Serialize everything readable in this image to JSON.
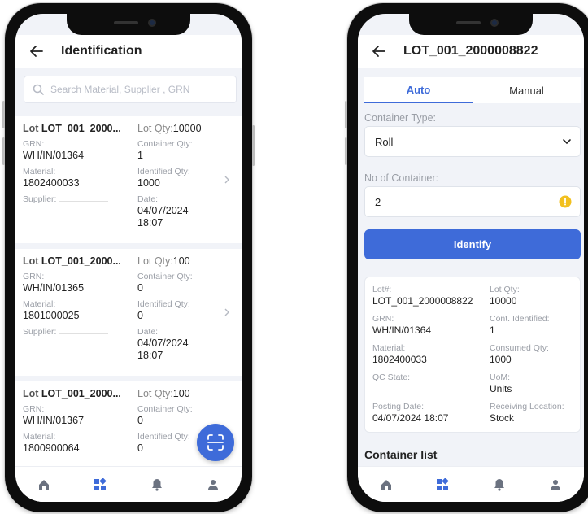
{
  "left_screen": {
    "title": "Identification",
    "search_placeholder": "Search Material, Supplier , GRN",
    "labels": {
      "lot": "Lot",
      "lot_qty": "Lot Qty:",
      "grn": "GRN:",
      "container_qty": "Container Qty:",
      "material": "Material:",
      "identified_qty": "Identified Qty:",
      "supplier": "Supplier:",
      "date": "Date:"
    },
    "cards": [
      {
        "lot": "LOT_001_2000...",
        "lot_qty": "10000",
        "grn": "WH/IN/01364",
        "container_qty": "1",
        "material": "1802400033",
        "identified_qty": "1000",
        "date": "04/07/2024",
        "time": "18:07"
      },
      {
        "lot": "LOT_001_2000...",
        "lot_qty": "100",
        "grn": "WH/IN/01365",
        "container_qty": "0",
        "material": "1801000025",
        "identified_qty": "0",
        "date": "04/07/2024",
        "time": "18:07"
      },
      {
        "lot": "LOT_001_2000...",
        "lot_qty": "100",
        "grn": "WH/IN/01367",
        "container_qty": "0",
        "material": "1800900064",
        "identified_qty": "0"
      }
    ]
  },
  "right_screen": {
    "title": "LOT_001_2000008822",
    "tabs": {
      "auto": "Auto",
      "manual": "Manual"
    },
    "container_type_label": "Container Type:",
    "container_type_value": "Roll",
    "no_of_container_label": "No of Container:",
    "no_of_container_value": "2",
    "identify_button": "Identify",
    "details": {
      "lot_label": "Lot#:",
      "lot_value": "LOT_001_2000008822",
      "lot_qty_label": "Lot Qty:",
      "lot_qty_value": "10000",
      "grn_label": "GRN:",
      "grn_value": "WH/IN/01364",
      "cont_identified_label": "Cont. Identified:",
      "cont_identified_value": "1",
      "material_label": "Material:",
      "material_value": "1802400033",
      "consumed_qty_label": "Consumed Qty:",
      "consumed_qty_value": "1000",
      "qc_state_label": "QC State:",
      "uom_label": "UoM:",
      "uom_value": "Units",
      "posting_date_label": "Posting Date:",
      "posting_date_value": "04/07/2024 18:07",
      "receiving_location_label": "Receiving Location:",
      "receiving_location_value": "Stock"
    },
    "container_list_title": "Container list"
  },
  "colors": {
    "primary": "#3e6bd9",
    "screen_bg": "#f1f3f8",
    "info": "#f2c01e"
  },
  "icons": [
    "back-arrow-icon",
    "search-icon",
    "chevron-right-icon",
    "scan-icon",
    "chevron-down-icon",
    "info-icon",
    "home-icon",
    "dashboard-icon",
    "bell-icon",
    "user-icon"
  ]
}
